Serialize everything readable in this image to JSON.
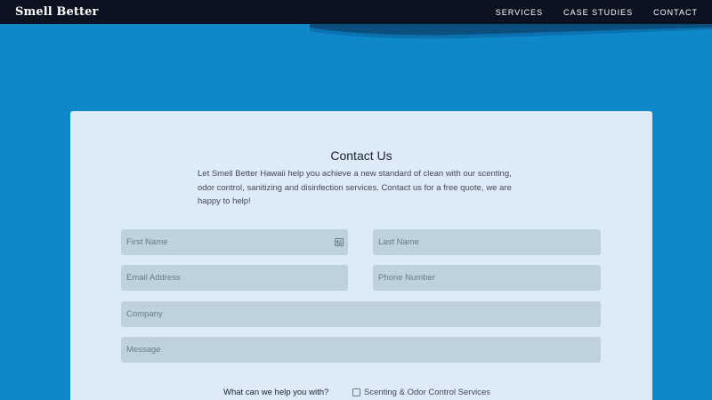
{
  "header": {
    "brand": "Smell Better",
    "nav": [
      "SERVICES",
      "CASE STUDIES",
      "CONTACT"
    ]
  },
  "contact": {
    "title": "Contact Us",
    "intro": "Let Smell Better Hawaii help you achieve a new standard of clean with our scenting, odor control, sanitizing and disinfection services. Contact us for a free quote, we are happy to help!",
    "fields": {
      "first_name": "First Name",
      "last_name": "Last Name",
      "email": "Email Address",
      "phone": "Phone Number",
      "company": "Company",
      "message": "Message"
    },
    "help_question": "What can we help you with?",
    "options": [
      "Scenting & Odor Control Services"
    ]
  },
  "colors": {
    "header_bg": "#0b1320",
    "page_bg": "#0e88c8",
    "card_bg": "#ddebf6",
    "field_bg": "#bfd1db"
  }
}
